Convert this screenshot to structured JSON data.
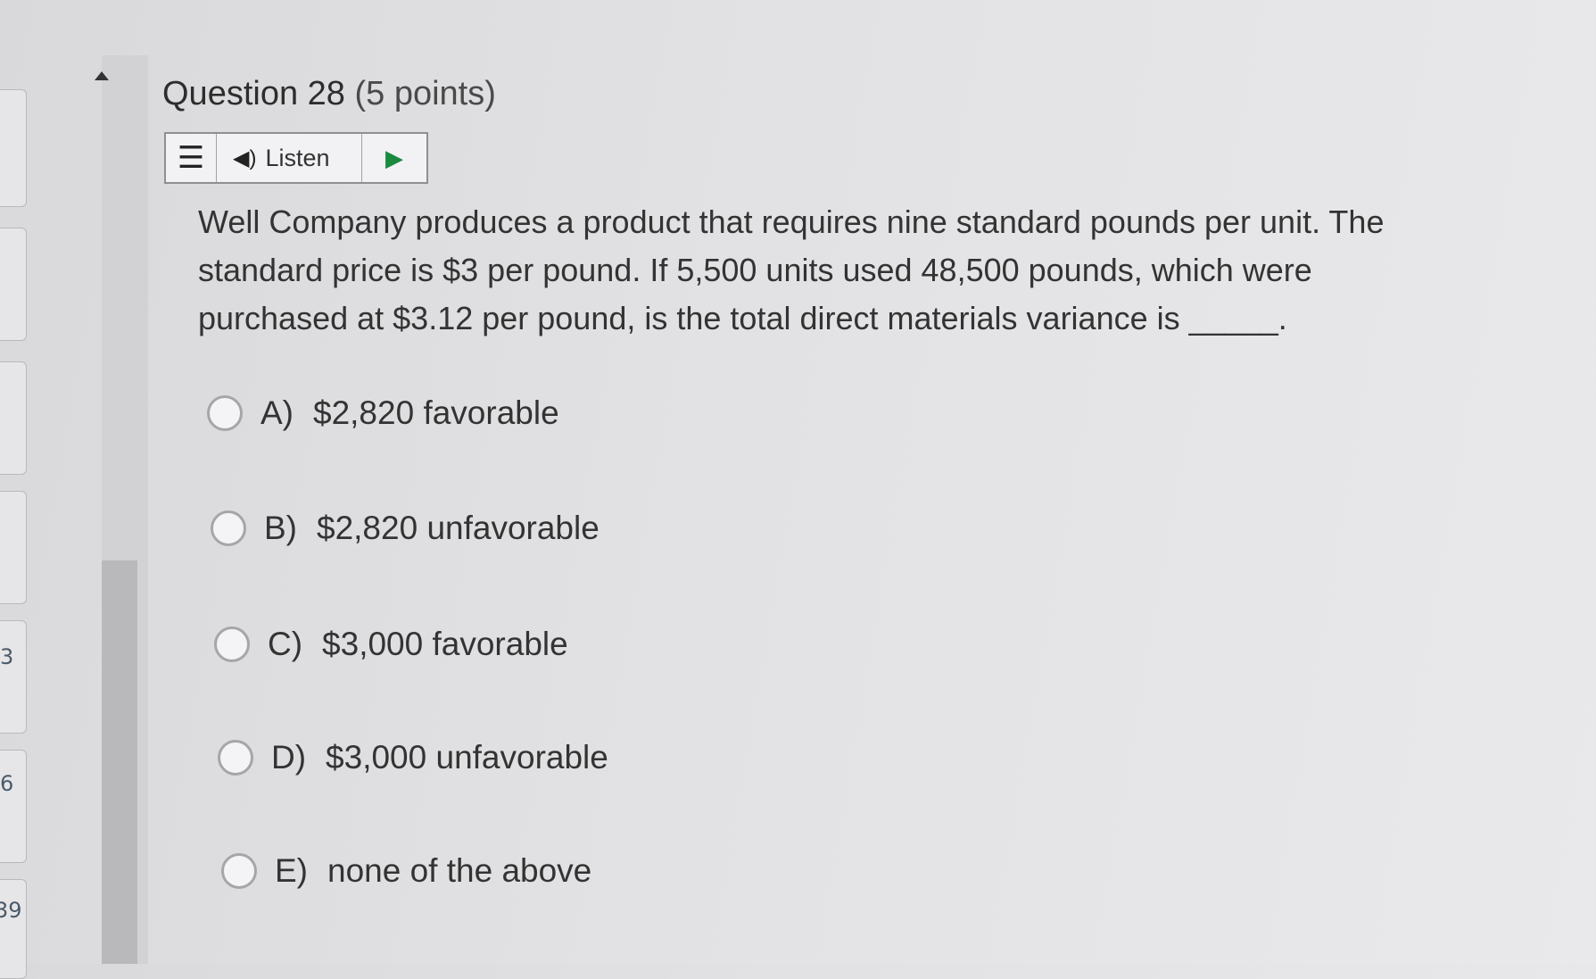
{
  "question": {
    "title": "Question 28",
    "points": "(5 points)",
    "text": "Well Company produces a product that requires nine standard pounds per unit. The standard price is $3 per pound. If 5,500 units used 48,500 pounds, which were purchased at $3.12 per pound, is the total direct materials variance is _____."
  },
  "listen_bar": {
    "menu_icon": "menu-icon",
    "listen_label": "Listen",
    "speaker_icon": "speaker-icon",
    "play_icon": "play-icon",
    "play_color": "#1a8a3e"
  },
  "options": [
    {
      "letter": "A)",
      "text": "$2,820 favorable"
    },
    {
      "letter": "B)",
      "text": "$2,820 unfavorable"
    },
    {
      "letter": "C)",
      "text": "$3,000 favorable"
    },
    {
      "letter": "D)",
      "text": "$3,000 unfavorable"
    },
    {
      "letter": "E)",
      "text": "none of the above"
    }
  ],
  "rail_numbers": [
    "3",
    "6",
    "39"
  ]
}
